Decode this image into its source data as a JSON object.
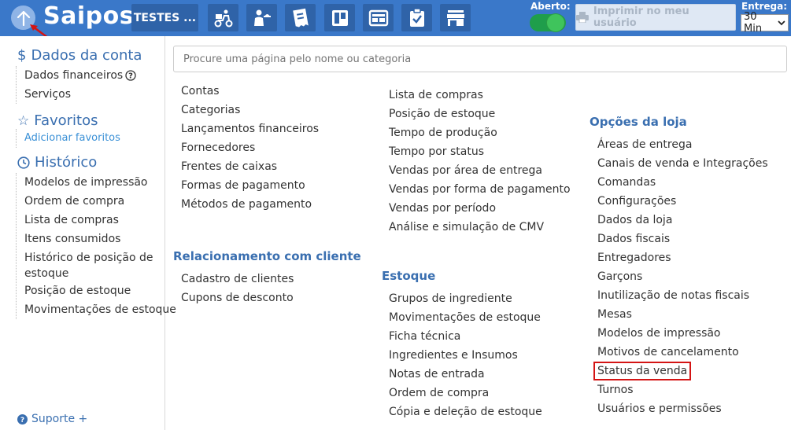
{
  "topbar": {
    "brand": "Saipos",
    "store_button": "TESTES ...",
    "aberto_label": "Aberto:",
    "print_button": "Imprimir no meu usuário",
    "entrega_label": "Entrega:",
    "entrega_value": "30 Min",
    "tools": [
      "delivery-icon",
      "waiter-icon",
      "order-ticket-icon",
      "kanban-icon",
      "panel-icon",
      "checklist-icon",
      "store-icon"
    ],
    "colors": {
      "bar": "#3a78c9",
      "tool": "#2f63a8",
      "toggle": "#1f9e4b"
    }
  },
  "sidebar": {
    "account_title": "Dados da conta",
    "account_items": [
      "Dados financeiros",
      "Serviços"
    ],
    "favorites_title": "Favoritos",
    "favorites_link": "Adicionar favoritos",
    "history_title": "Histórico",
    "history_items": [
      "Modelos de impressão",
      "Ordem de compra",
      "Lista de compras",
      "Itens consumidos",
      "Histórico de posição de",
      "estoque",
      "Posição de estoque",
      "Movimentações de estoque"
    ],
    "support": "Suporte +"
  },
  "search": {
    "placeholder": "Procure uma página pelo nome ou categoria"
  },
  "columns": {
    "col1_items": [
      "Contas",
      "Categorias",
      "Lançamentos financeiros",
      "Fornecedores",
      "Frentes de caixas",
      "Formas de pagamento",
      "Métodos de pagamento"
    ],
    "relacionamento_title": "Relacionamento com cliente",
    "relacionamento_items": [
      "Cadastro de clientes",
      "Cupons de desconto"
    ],
    "col2_items": [
      "Lista de compras",
      "Posição de estoque",
      "Tempo de produção",
      "Tempo por status",
      "Vendas por área de entrega",
      "Vendas por forma de pagamento",
      "Vendas por período",
      "Análise e simulação de CMV"
    ],
    "estoque_title": "Estoque",
    "estoque_items": [
      "Grupos de ingrediente",
      "Movimentações de estoque",
      "Ficha técnica",
      "Ingredientes e Insumos",
      "Notas de entrada",
      "Ordem de compra",
      "Cópia e deleção de estoque"
    ],
    "loja_title": "Opções da loja",
    "loja_items": [
      "Áreas de entrega",
      "Canais de venda e Integrações",
      "Comandas",
      "Configurações",
      "Dados da loja",
      "Dados fiscais",
      "Entregadores",
      "Garçons",
      "Inutilização de notas fiscais",
      "Mesas",
      "Modelos de impressão",
      "Motivos de cancelamento",
      "Status da venda",
      "Turnos",
      "Usuários e permissões"
    ]
  }
}
